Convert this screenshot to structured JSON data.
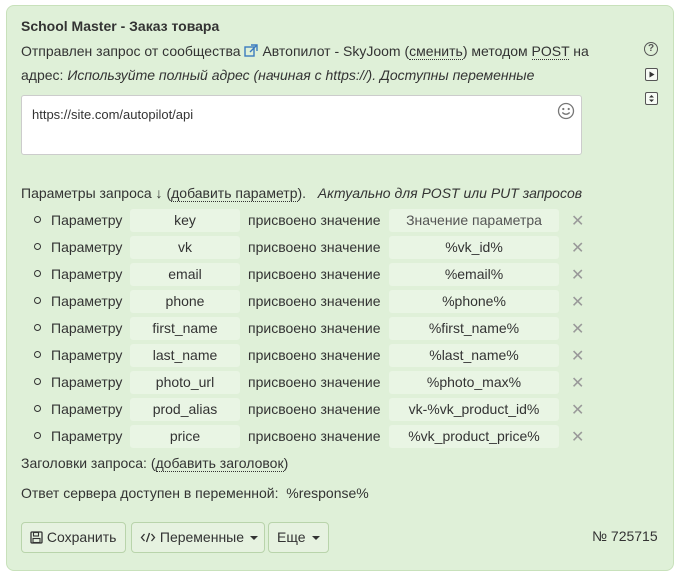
{
  "panel": {
    "title": "School Master - Заказ товара",
    "intro": {
      "prefix": "Отправлен запрос от сообщества",
      "community": "Автопилот - SkyJoom",
      "open_paren": " (",
      "change_link": "сменить",
      "close_paren": ")",
      "method_prefix": " методом ",
      "method": "POST",
      "suffix": " на",
      "address_label": "адрес:",
      "address_hint": "Используйте полный адрес (начиная с https://). Доступны переменные"
    },
    "url": {
      "value": "https://site.com/autopilot/api"
    },
    "params": {
      "heading": "Параметры запроса ↓ (",
      "add_link": "добавить параметр",
      "heading_end": ").",
      "note": "Актуально для POST или PUT запросов",
      "label_param": "Параметру",
      "label_assign": "присвоено значение",
      "remove_glyph": "✕",
      "rows": [
        {
          "key": "key",
          "value": "Значение параметра"
        },
        {
          "key": "vk",
          "value": "%vk_id%"
        },
        {
          "key": "email",
          "value": "%email%"
        },
        {
          "key": "phone",
          "value": "%phone%"
        },
        {
          "key": "first_name",
          "value": "%first_name%"
        },
        {
          "key": "last_name",
          "value": "%last_name%"
        },
        {
          "key": "photo_url",
          "value": "%photo_max%"
        },
        {
          "key": "prod_alias",
          "value": "vk-%vk_product_id%"
        },
        {
          "key": "price",
          "value": "%vk_product_price%"
        }
      ]
    },
    "headers": {
      "label": "Заголовки запроса: (",
      "add_link": "добавить заголовок",
      "end": ")"
    },
    "response": {
      "label": "Ответ сервера доступен в переменной:",
      "variable": "%response%"
    },
    "buttons": {
      "save": "Сохранить",
      "variables": "Переменные",
      "more": "Еще"
    },
    "order_number": "№ 725715",
    "side_icons": {
      "help": "?",
      "help_icon": "question-circle-icon",
      "play_icon": "play-icon",
      "sort_icon": "sort-icon"
    },
    "colors": {
      "panel_bg": "#dff0d8",
      "pill_bg": "#e9f5e4",
      "link_color": "#3a7bbf"
    }
  }
}
